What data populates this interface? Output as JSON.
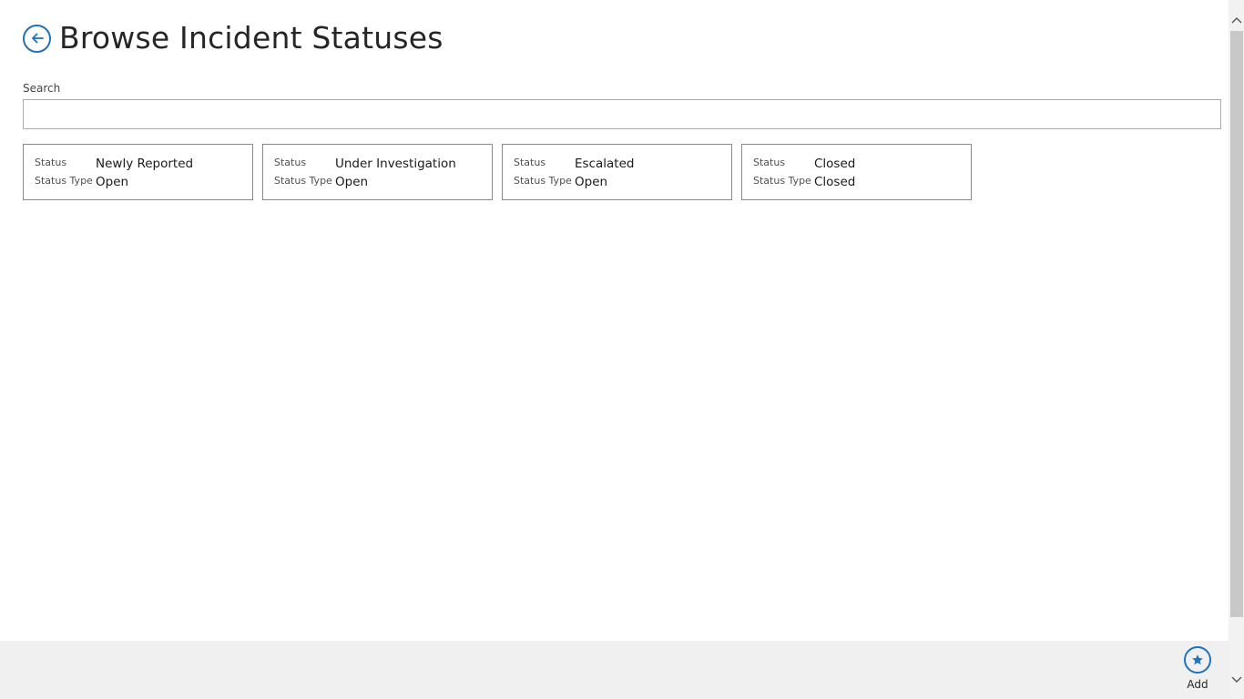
{
  "header": {
    "title": "Browse Incident Statuses",
    "back_icon": "back-arrow-circle-icon"
  },
  "search": {
    "label": "Search",
    "value": "",
    "placeholder": ""
  },
  "tiles": [
    {
      "status_label": "Status",
      "status": "Newly Reported",
      "type_label": "Status Type",
      "type": "Open"
    },
    {
      "status_label": "Status",
      "status": "Under Investigation",
      "type_label": "Status Type",
      "type": "Open"
    },
    {
      "status_label": "Status",
      "status": "Escalated",
      "type_label": "Status Type",
      "type": "Open"
    },
    {
      "status_label": "Status",
      "status": "Closed",
      "type_label": "Status Type",
      "type": "Closed"
    }
  ],
  "appbar": {
    "add_label": "Add",
    "add_icon": "star-circle-icon"
  },
  "colors": {
    "accent": "#1e73be",
    "appbar_bg": "#f0f0f0",
    "tile_border": "#8a8a8a"
  }
}
